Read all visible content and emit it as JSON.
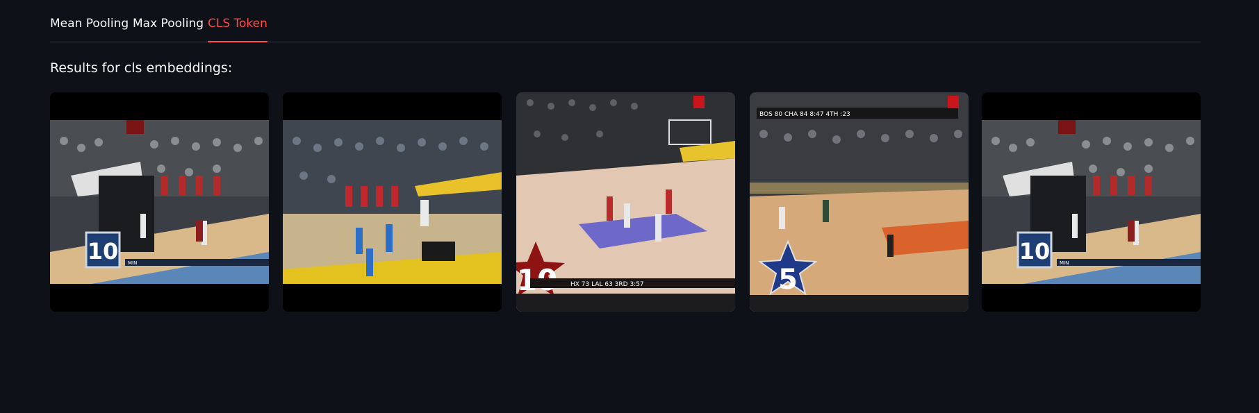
{
  "tabs": [
    {
      "label": "Mean Pooling",
      "active": false
    },
    {
      "label": "Max Pooling",
      "active": false
    },
    {
      "label": "CLS Token",
      "active": true
    }
  ],
  "results": {
    "heading": "Results for cls embeddings:"
  },
  "thumbnails": [
    {
      "badge": "10",
      "score": "MIN"
    },
    {
      "badge": "",
      "score": ""
    },
    {
      "badge": "10",
      "score": "HX 73 LAL 63 3RD 3:57"
    },
    {
      "badge": "5",
      "score": "BOS 80 CHA 84 8:47 4TH :23"
    },
    {
      "badge": "10",
      "score": "MIN"
    }
  ],
  "colors": {
    "background": "#0e1117",
    "accent": "#ff4b4b",
    "text": "#fafafa"
  }
}
